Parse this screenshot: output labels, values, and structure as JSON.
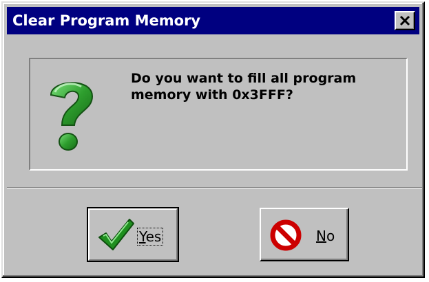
{
  "window": {
    "title": "Clear Program Memory",
    "close_label": "Close"
  },
  "dialog": {
    "message": "Do you want to fill all program memory with 0x3FFF?",
    "icon": "question-icon"
  },
  "buttons": {
    "yes": {
      "mnemonic": "Y",
      "rest": "es",
      "icon": "checkmark-icon",
      "default": true
    },
    "no": {
      "mnemonic": "N",
      "rest": "o",
      "icon": "no-entry-icon"
    }
  },
  "colors": {
    "titlebar": "#000080",
    "face": "#c0c0c0",
    "question_mark": "#2e9e2e",
    "checkmark": "#1f8f1f",
    "no_sign": "#cc0000"
  }
}
